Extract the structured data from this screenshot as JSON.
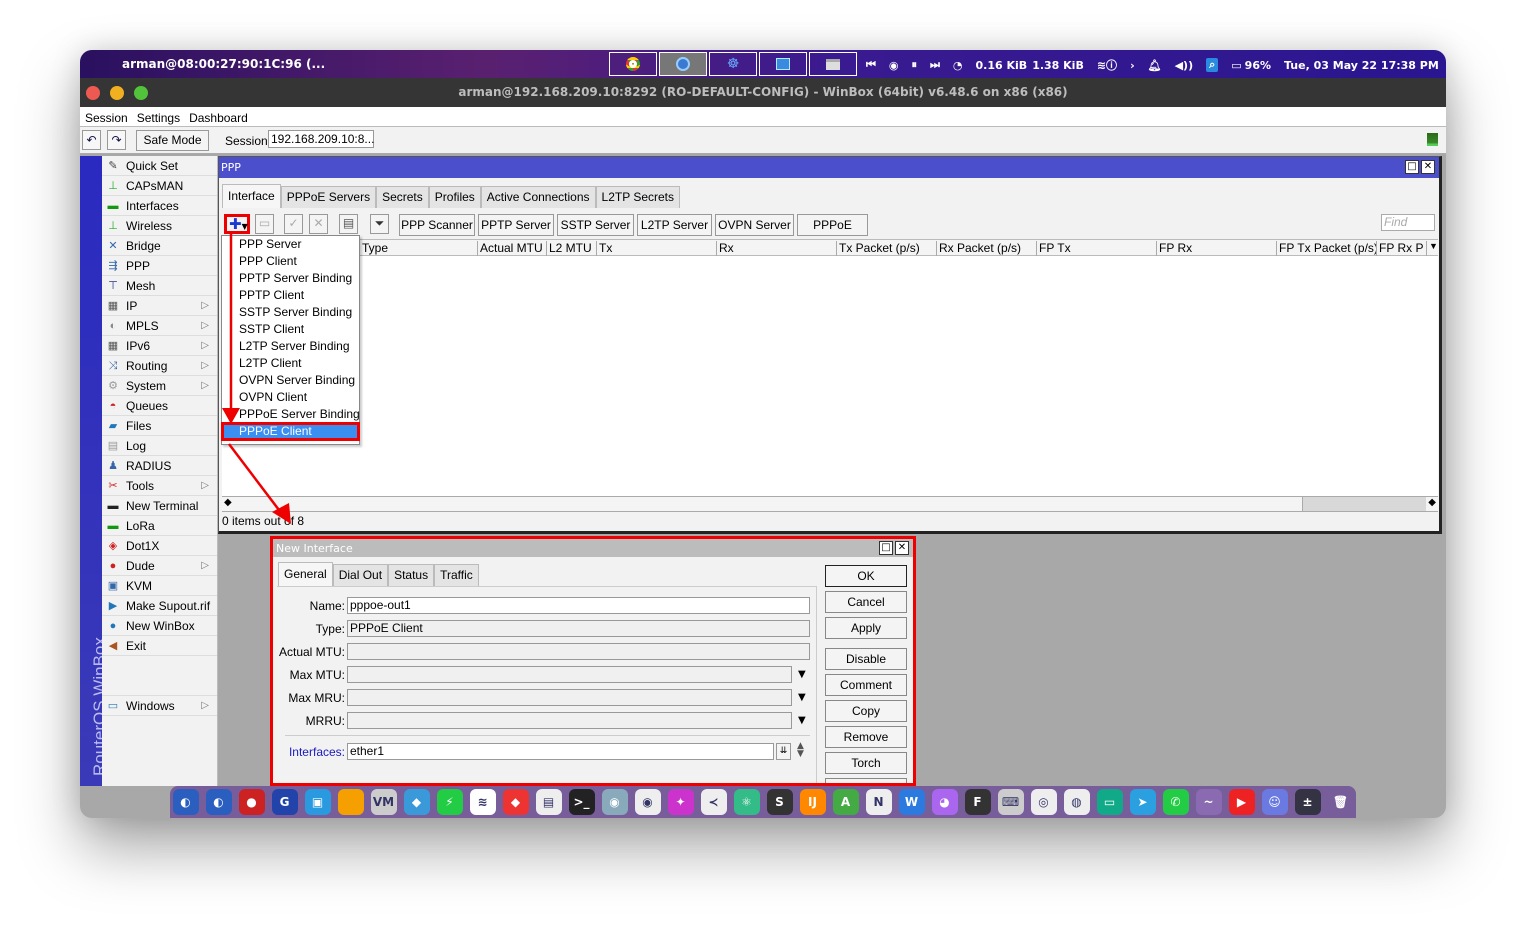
{
  "menubar": {
    "user_host": "arman@08:00:27:90:1C:96 (...",
    "task_buttons": [
      "chrome-icon",
      "winbox-icon",
      "gnome-icon",
      "monitor-icon",
      "window-icon"
    ],
    "net_down": "0.16 KiB",
    "net_up": "1.38 KiB",
    "battery": "96%",
    "datetime": "Tue, 03 May 22  17:38 PM"
  },
  "window": {
    "title": "arman@192.168.209.10:8292 (RO-DEFAULT-CONFIG) - WinBox (64bit) v6.48.6 on x86 (x86)"
  },
  "appmenu": [
    "Session",
    "Settings",
    "Dashboard"
  ],
  "toolbar": {
    "safe_mode": "Safe Mode",
    "session_label": "Session:",
    "session_value": "192.168.209.10:8..."
  },
  "sidebar": {
    "brand": "RouterOS WinBox",
    "items": [
      {
        "label": "Quick Set",
        "icon": "✎",
        "color": "#444",
        "sub": false
      },
      {
        "label": "CAPsMAN",
        "icon": "⊥",
        "color": "#2a2",
        "sub": false
      },
      {
        "label": "Interfaces",
        "icon": "▬",
        "color": "#191",
        "sub": false
      },
      {
        "label": "Wireless",
        "icon": "⊥",
        "color": "#2a2",
        "sub": false
      },
      {
        "label": "Bridge",
        "icon": "✕",
        "color": "#36a",
        "sub": false
      },
      {
        "label": "PPP",
        "icon": "⇶",
        "color": "#36a",
        "sub": false
      },
      {
        "label": "Mesh",
        "icon": "⊤",
        "color": "#238",
        "sub": false
      },
      {
        "label": "IP",
        "icon": "▦",
        "color": "#555",
        "sub": true
      },
      {
        "label": "MPLS",
        "icon": "◐",
        "color": "#888",
        "sub": true
      },
      {
        "label": "IPv6",
        "icon": "▦",
        "color": "#555",
        "sub": true
      },
      {
        "label": "Routing",
        "icon": "⤨",
        "color": "#36a",
        "sub": true
      },
      {
        "label": "System",
        "icon": "⚙",
        "color": "#999",
        "sub": true
      },
      {
        "label": "Queues",
        "icon": "◓",
        "color": "#c22",
        "sub": false
      },
      {
        "label": "Files",
        "icon": "▰",
        "color": "#27b",
        "sub": false
      },
      {
        "label": "Log",
        "icon": "▤",
        "color": "#999",
        "sub": false
      },
      {
        "label": "RADIUS",
        "icon": "♟",
        "color": "#36a",
        "sub": false
      },
      {
        "label": "Tools",
        "icon": "✂",
        "color": "#c22",
        "sub": true
      },
      {
        "label": "New Terminal",
        "icon": "▬",
        "color": "#222",
        "sub": false
      },
      {
        "label": "LoRa",
        "icon": "▬",
        "color": "#191",
        "sub": false
      },
      {
        "label": "Dot1X",
        "icon": "◈",
        "color": "#c22",
        "sub": false
      },
      {
        "label": "Dude",
        "icon": "●",
        "color": "#c22",
        "sub": true
      },
      {
        "label": "KVM",
        "icon": "▣",
        "color": "#36a",
        "sub": false
      },
      {
        "label": "Make Supout.rif",
        "icon": "▶",
        "color": "#27b",
        "sub": false
      },
      {
        "label": "New WinBox",
        "icon": "●",
        "color": "#27b",
        "sub": false
      },
      {
        "label": "Exit",
        "icon": "◀",
        "color": "#a52",
        "sub": false
      },
      {
        "label": "",
        "icon": "",
        "color": "#000",
        "sub": false
      },
      {
        "label": "Windows",
        "icon": "▭",
        "color": "#27b",
        "sub": true
      }
    ]
  },
  "ppp": {
    "title": "PPP",
    "tabs": [
      "Interface",
      "PPPoE Servers",
      "Secrets",
      "Profiles",
      "Active Connections",
      "L2TP Secrets"
    ],
    "active_tab": "Interface",
    "buttons": [
      "PPP Scanner",
      "PPTP Server",
      "SSTP Server",
      "L2TP Server",
      "OVPN Server",
      "PPPoE Scan"
    ],
    "find_placeholder": "Find",
    "columns": [
      "Type",
      "Actual MTU",
      "L2 MTU",
      "Tx",
      "Rx",
      "Tx Packet (p/s)",
      "Rx Packet (p/s)",
      "FP Tx",
      "FP Rx",
      "FP Tx Packet (p/s)",
      "FP Rx Pa"
    ],
    "status": "0 items out of 8",
    "add_menu": [
      "PPP Server",
      "PPP Client",
      "PPTP Server Binding",
      "PPTP Client",
      "SSTP Server Binding",
      "SSTP Client",
      "L2TP Server Binding",
      "L2TP Client",
      "OVPN Server Binding",
      "OVPN Client",
      "PPPoE Server Binding",
      "PPPoE Client"
    ],
    "add_menu_selected": "PPPoE Client"
  },
  "new_interface": {
    "title": "New Interface",
    "tabs": [
      "General",
      "Dial Out",
      "Status",
      "Traffic"
    ],
    "active_tab": "General",
    "fields": {
      "name": {
        "label": "Name:",
        "value": "pppoe-out1"
      },
      "type": {
        "label": "Type:",
        "value": "PPPoE Client"
      },
      "actual_mtu": {
        "label": "Actual MTU:",
        "value": ""
      },
      "max_mtu": {
        "label": "Max MTU:",
        "value": ""
      },
      "max_mru": {
        "label": "Max MRU:",
        "value": ""
      },
      "mrru": {
        "label": "MRRU:",
        "value": ""
      },
      "interfaces": {
        "label": "Interfaces:",
        "value": "ether1"
      }
    },
    "buttons": [
      "OK",
      "Cancel",
      "Apply",
      "Disable",
      "Comment",
      "Copy",
      "Remove",
      "Torch"
    ]
  },
  "dock": {
    "apps": [
      {
        "name": "winbox-icon",
        "bg": "#2a5fc0",
        "g": "◐"
      },
      {
        "name": "winbox2-icon",
        "bg": "#2a5fc0",
        "g": "◐"
      },
      {
        "name": "dude-icon",
        "bg": "#c22",
        "g": "●"
      },
      {
        "name": "gnome-icon",
        "bg": "#2244aa",
        "g": "G"
      },
      {
        "name": "files-icon",
        "bg": "#2a9ae0",
        "g": "▣"
      },
      {
        "name": "notes-icon",
        "bg": "#f5a000",
        "g": " "
      },
      {
        "name": "vmware-icon",
        "bg": "#ccc",
        "g": "VM"
      },
      {
        "name": "vbox-icon",
        "bg": "#3a9ad9",
        "g": "◆"
      },
      {
        "name": "bolt-icon",
        "bg": "#2c4",
        "g": "⚡"
      },
      {
        "name": "wifi-icon",
        "bg": "#fff",
        "g": "≋"
      },
      {
        "name": "anydesk-icon",
        "bg": "#e33",
        "g": "◆"
      },
      {
        "name": "remote-icon",
        "bg": "#eee",
        "g": "▤"
      },
      {
        "name": "terminal-icon",
        "bg": "#222",
        "g": ">_"
      },
      {
        "name": "eye-icon",
        "bg": "#8ab",
        "g": "◉"
      },
      {
        "name": "camera-icon",
        "bg": "#eee",
        "g": "◉"
      },
      {
        "name": "paint-icon",
        "bg": "#c3c",
        "g": "✦"
      },
      {
        "name": "vscode-icon",
        "bg": "#eee",
        "g": "≺"
      },
      {
        "name": "atom-icon",
        "bg": "#3b8",
        "g": "⚛"
      },
      {
        "name": "sublime-icon",
        "bg": "#333",
        "g": "S"
      },
      {
        "name": "intellij-icon",
        "bg": "#f80",
        "g": "IJ"
      },
      {
        "name": "android-icon",
        "bg": "#4a4",
        "g": "A"
      },
      {
        "name": "nvim-icon",
        "bg": "#eee",
        "g": "N"
      },
      {
        "name": "word-icon",
        "bg": "#2a7ae0",
        "g": "W"
      },
      {
        "name": "github-icon",
        "bg": "#a6e",
        "g": "◕"
      },
      {
        "name": "figma-icon",
        "bg": "#333",
        "g": "F"
      },
      {
        "name": "keyboard-icon",
        "bg": "#ccc",
        "g": "⌨"
      },
      {
        "name": "chrome-icon",
        "bg": "#eee",
        "g": "◎"
      },
      {
        "name": "firefox-icon",
        "bg": "#eee",
        "g": "◍"
      },
      {
        "name": "game-icon",
        "bg": "#1a8",
        "g": "▭"
      },
      {
        "name": "telegram-icon",
        "bg": "#2aa0e0",
        "g": "➤"
      },
      {
        "name": "whatsapp-icon",
        "bg": "#2c4",
        "g": "✆"
      },
      {
        "name": "mustache-icon",
        "bg": "#8a6ab0",
        "g": "~"
      },
      {
        "name": "youtube-icon",
        "bg": "#e22",
        "g": "▶"
      },
      {
        "name": "discord-icon",
        "bg": "#6a7ae0",
        "g": "☺"
      },
      {
        "name": "calculator-icon",
        "bg": "#334",
        "g": "±"
      },
      {
        "name": "trash-icon",
        "bg": "transparent",
        "g": "🗑"
      }
    ]
  }
}
